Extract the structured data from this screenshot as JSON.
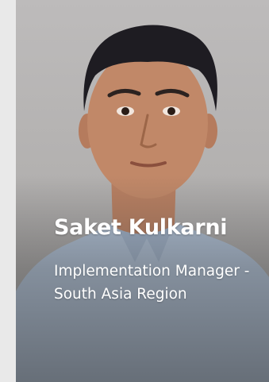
{
  "profile": {
    "name": "Saket Kulkarni",
    "title": "Implementation Manager - South Asia Region",
    "photo_icon": "person-portrait-icon"
  },
  "colors": {
    "page_background": "#ebebeb",
    "card_background": "#b3b1b0",
    "caption_text": "#ffffff",
    "shirt": "#aebfd4"
  }
}
